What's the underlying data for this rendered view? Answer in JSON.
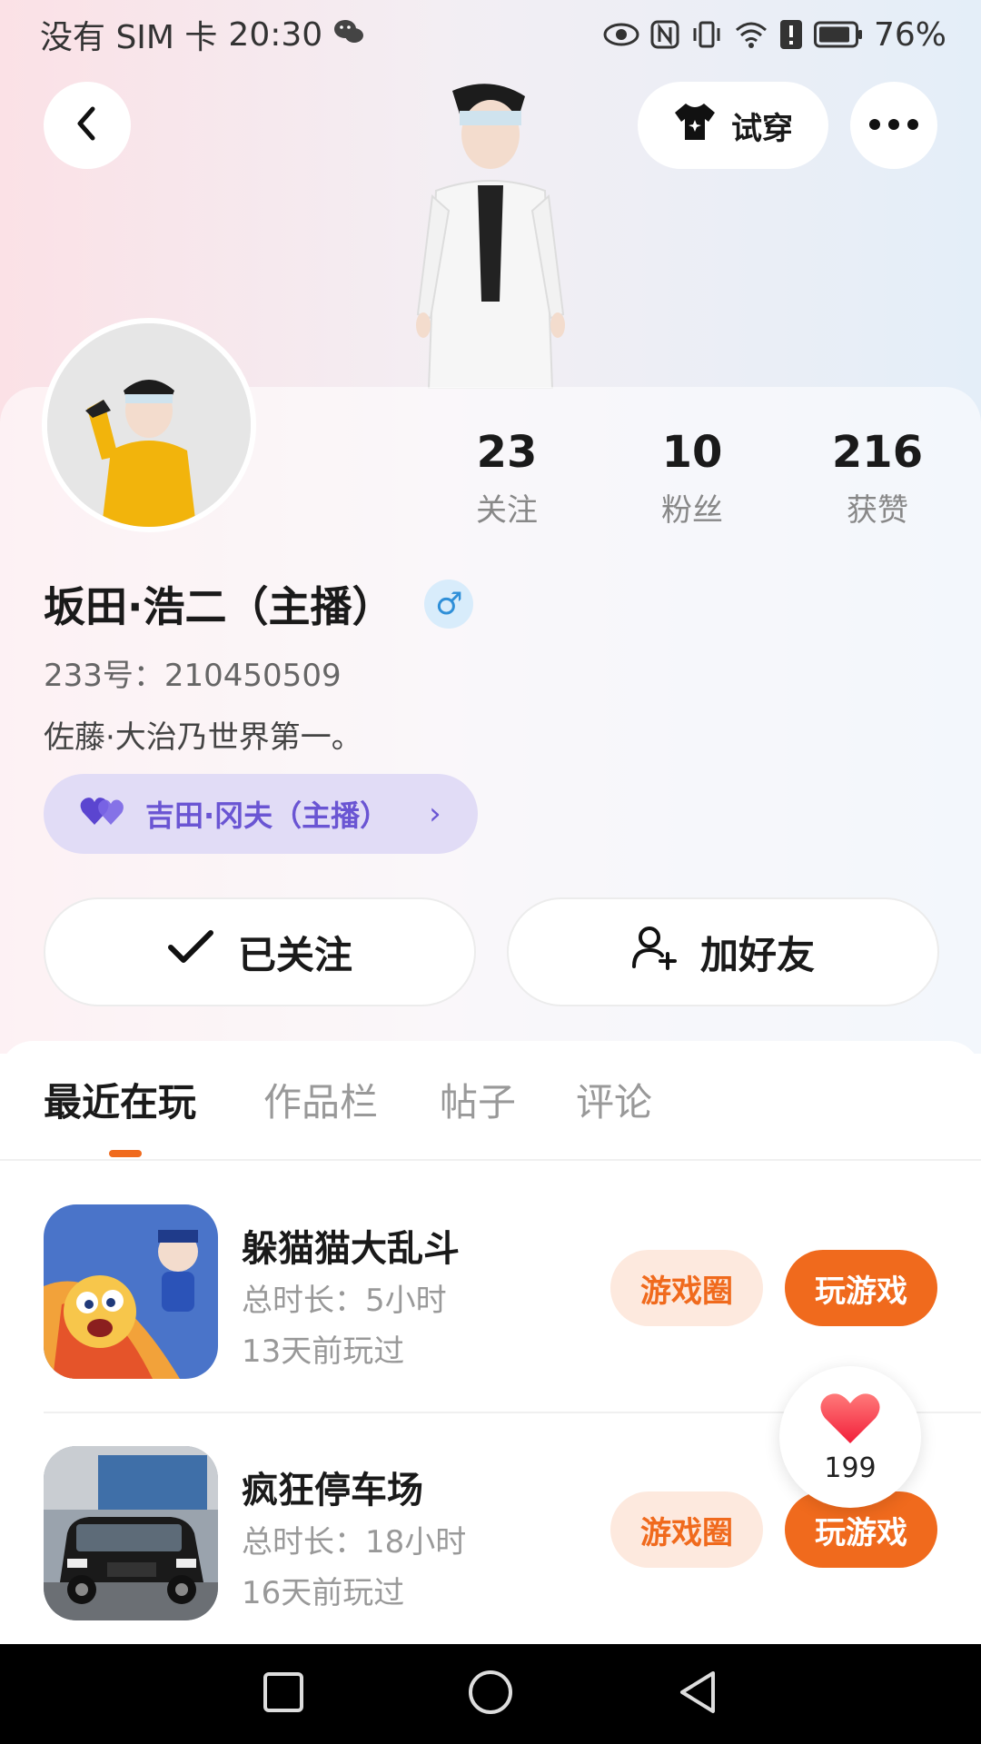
{
  "status_bar": {
    "carrier": "没有 SIM 卡",
    "time": "20:30",
    "battery": "76%",
    "icons": [
      "wechat-icon",
      "eye-icon",
      "nfc-icon",
      "vibrate-icon",
      "wifi-icon",
      "alert-icon",
      "battery-icon"
    ]
  },
  "header": {
    "tryon_label": "试穿",
    "icons": [
      "back-icon",
      "shirt-icon",
      "more-icon"
    ]
  },
  "profile": {
    "stats": [
      {
        "value": "23",
        "label": "关注"
      },
      {
        "value": "10",
        "label": "粉丝"
      },
      {
        "value": "216",
        "label": "获赞"
      }
    ],
    "name": "坂田·浩二（主播）",
    "gender_symbol": "♂",
    "uid": "233号：210450509",
    "bio": "佐藤·大治乃世界第一。",
    "partner": {
      "label": "吉田·冈夫（主播）",
      "chevron": "›"
    }
  },
  "actions": {
    "follow_label": "已关注",
    "add_friend_label": "加好友"
  },
  "tabs": [
    "最近在玩",
    "作品栏",
    "帖子",
    "评论"
  ],
  "games": [
    {
      "title": "躲猫猫大乱斗",
      "duration": "总时长：5小时",
      "last_played": "13天前玩过",
      "circle_label": "游戏圈",
      "play_label": "玩游戏"
    },
    {
      "title": "疯狂停车场",
      "duration": "总时长：18小时",
      "last_played": "16天前玩过",
      "circle_label": "游戏圈",
      "play_label": "玩游戏"
    }
  ],
  "like": {
    "count": "199"
  },
  "colors": {
    "accent": "#f06a1d",
    "accent_light": "#fde9de",
    "partner_bg": "#e1dcf6",
    "partner_text": "#6a55d3"
  }
}
